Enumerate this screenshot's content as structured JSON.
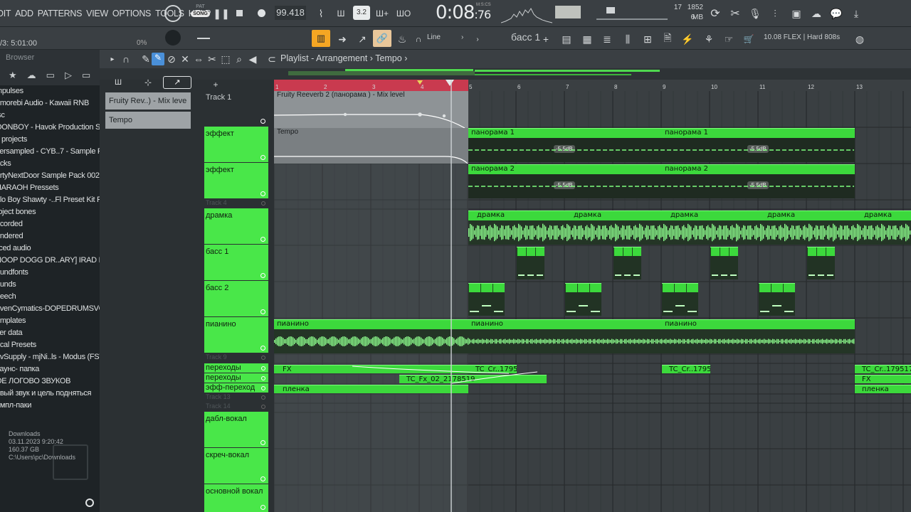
{
  "menu": [
    "DIT",
    "ADD",
    "PATTERNS",
    "VIEW",
    "OPTIONS",
    "TOOLS",
    "HELP"
  ],
  "transport": {
    "pat_label": "PAT",
    "song_label": "SONG",
    "tempo": "99.418",
    "time_main": "0:08",
    "time_frac": "76",
    "time_mode": "M:S:CS"
  },
  "perf": {
    "cpu": "17",
    "ram": "1852 MB",
    "polyphony": "6"
  },
  "toolbar2": {
    "position": "/3: 5:01:00",
    "cpu_pct": "0%",
    "snap": "Line",
    "pattern": "басс 1",
    "plugin_info": "10.08  FLEX | Hard 808s"
  },
  "browser": {
    "title": "Browser",
    "items": [
      "mpulses",
      "omorebi Audio - Kawaii RNB",
      "isc",
      "OONBOY - Havok Production Suite",
      "y projects",
      "versampled - CYB..7 - Sample Pack",
      "acks",
      "artyNextDoor Sample Pack 002",
      "HARAOH Pressets",
      "olo Boy Shawty -..Fl Preset Kit FST",
      "roject bones",
      "ecorded",
      "endered",
      "liced audio",
      "NOOP DOGG DR..ARY] IRAD BEATS",
      "oundfonts",
      "ounds",
      "peech",
      "evenCymatics-DOPEDRUMSVOL.1",
      "emplates",
      "ser data",
      "ocal Presets",
      "avSupply - mjNi..ls - Modus (FST)",
      "ваунс- папка",
      "ОЕ ЛОГОВО ЗВУКОВ",
      "овый звук и цель подняться",
      "омпл-паки"
    ],
    "footer": {
      "folder": "Downloads",
      "date": "03.11.2023 9:20:42",
      "size": "160.37 GB",
      "path": "C:\\Users\\pc\\Downloads"
    }
  },
  "playlist": {
    "title": "Playlist - Arrangement",
    "tempo_crumb": "Tempo"
  },
  "clip_selector": [
    "Fruity Rev..) - Mix leve",
    "Tempo"
  ],
  "bars": [
    "1",
    "2",
    "3",
    "4",
    "5",
    "6",
    "7",
    "8",
    "9",
    "10",
    "11",
    "12",
    "13"
  ],
  "tracks": [
    {
      "name": "Track 1"
    },
    {
      "name": "эффект"
    },
    {
      "name": "эффект"
    },
    {
      "name": "Track 4"
    },
    {
      "name": "дрaмка"
    },
    {
      "name": "басс 1"
    },
    {
      "name": "басс 2"
    },
    {
      "name": "пианино"
    },
    {
      "name": "Track 9"
    },
    {
      "name": "переходы"
    },
    {
      "name": "переходы"
    },
    {
      "name": "эфф-переход"
    },
    {
      "name": "Track 13"
    },
    {
      "name": "Track 14"
    },
    {
      "name": "дабл-вокал"
    },
    {
      "name": "скреч-вокал"
    },
    {
      "name": "основной вокал"
    }
  ],
  "clips": {
    "reverb_auto": "Fruity Reeverb 2 (панорама ) - Mix level",
    "tempo_auto": "Tempo",
    "pan1": "панорама 1",
    "pan2": "панорама 2",
    "db": "-5.5dB",
    "drum": "дрaмка",
    "piano": "пианино",
    "fx": "FX",
    "tc_cr": "TC_Cr..179517",
    "tc_fx": "TC_Fx_02_2178519",
    "film": "пленка"
  },
  "colors": {
    "clip_green": "#3cd93c",
    "loop_red": "#c93a4f",
    "track_green": "#49e749"
  }
}
